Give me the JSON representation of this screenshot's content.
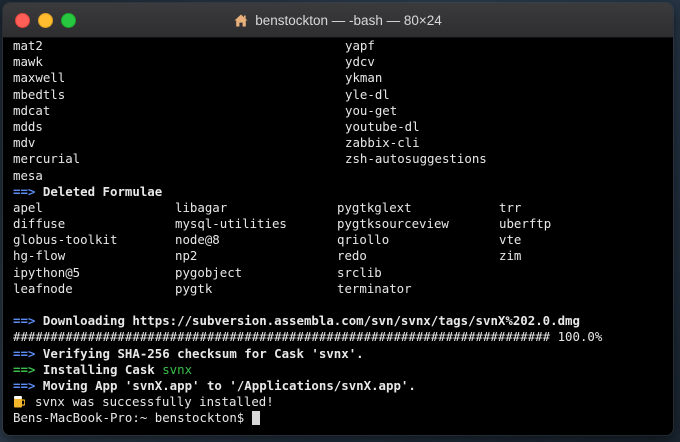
{
  "window": {
    "title": "benstockton — -bash — 80×24"
  },
  "terminal": {
    "formulae_list_1": [
      [
        "mat2",
        "yapf"
      ],
      [
        "mawk",
        "ydcv"
      ],
      [
        "maxwell",
        "ykman"
      ],
      [
        "mbedtls",
        "yle-dl"
      ],
      [
        "mdcat",
        "you-get"
      ],
      [
        "mdds",
        "youtube-dl"
      ],
      [
        "mdv",
        "zabbix-cli"
      ],
      [
        "mercurial",
        "zsh-autosuggestions"
      ],
      [
        "mesa",
        ""
      ]
    ],
    "deleted_header": {
      "arrow": "==>",
      "text": "Deleted Formulae"
    },
    "deleted_list": [
      [
        "apel",
        "libagar",
        "pygtkglext",
        "trr"
      ],
      [
        "diffuse",
        "mysql-utilities",
        "pygtksourceview",
        "uberftp"
      ],
      [
        "globus-toolkit",
        "node@8",
        "qriollo",
        "vte"
      ],
      [
        "hg-flow",
        "np2",
        "redo",
        "zim"
      ],
      [
        "ipython@5",
        "pygobject",
        "srclib",
        ""
      ],
      [
        "leafnode",
        "pygtk",
        "terminator",
        ""
      ]
    ],
    "download_line": {
      "arrow": "==>",
      "text": "Downloading https://subversion.assembla.com/svn/svnx/tags/svnX%202.0.dmg"
    },
    "progress_line": "######################################################################## 100.0%",
    "verify_line": {
      "arrow": "==>",
      "text": "Verifying SHA-256 checksum for Cask 'svnx'."
    },
    "install_line": {
      "arrow": "==>",
      "text": "Installing Cask ",
      "cask": "svnx"
    },
    "move_line": {
      "arrow": "==>",
      "text": "Moving App 'svnX.app' to '/Applications/svnX.app'."
    },
    "success_line": "svnx was successfully installed!",
    "prompt": "Bens-MacBook-Pro:~ benstockton$ "
  },
  "colors": {
    "arrow_blue": "#5b8df7",
    "arrow_green": "#3bc04a",
    "terminal_bg": "#000000",
    "text": "#e8e8e8"
  },
  "icons": {
    "home": "home-icon",
    "beer": "beer-mug-icon"
  }
}
